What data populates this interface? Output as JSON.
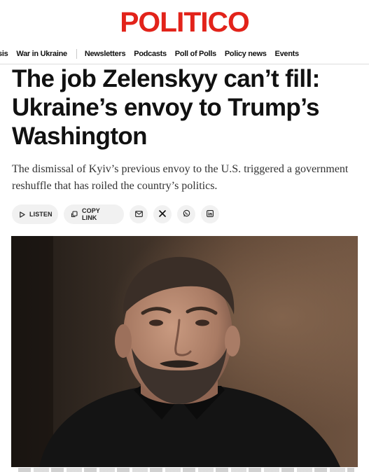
{
  "brand": {
    "logo_text": "POLITICO",
    "color": "#e2231a"
  },
  "nav": {
    "items_left": [
      "sis",
      "War in Ukraine"
    ],
    "items_right": [
      "Newsletters",
      "Podcasts",
      "Poll of Polls",
      "Policy news",
      "Events"
    ]
  },
  "article": {
    "headline": "The job Zelenskyy can’t fill: Ukraine’s envoy to Trump’s Washington",
    "dek": "The dismissal of Kyiv’s previous envoy to the U.S. triggered a government reshuffle that has roiled the country’s politics."
  },
  "actions": {
    "listen_label": "LISTEN",
    "copy_label": "COPY LINK",
    "icons": [
      "play-icon",
      "copy-icon",
      "email-icon",
      "x-icon",
      "whatsapp-icon",
      "linkedin-icon"
    ]
  },
  "photo": {
    "subject": "portrait-photo",
    "colors": {
      "background": "#4a3626",
      "shirt": "#141414",
      "skin": "#b98c74",
      "hair": "#3a2e27"
    }
  }
}
